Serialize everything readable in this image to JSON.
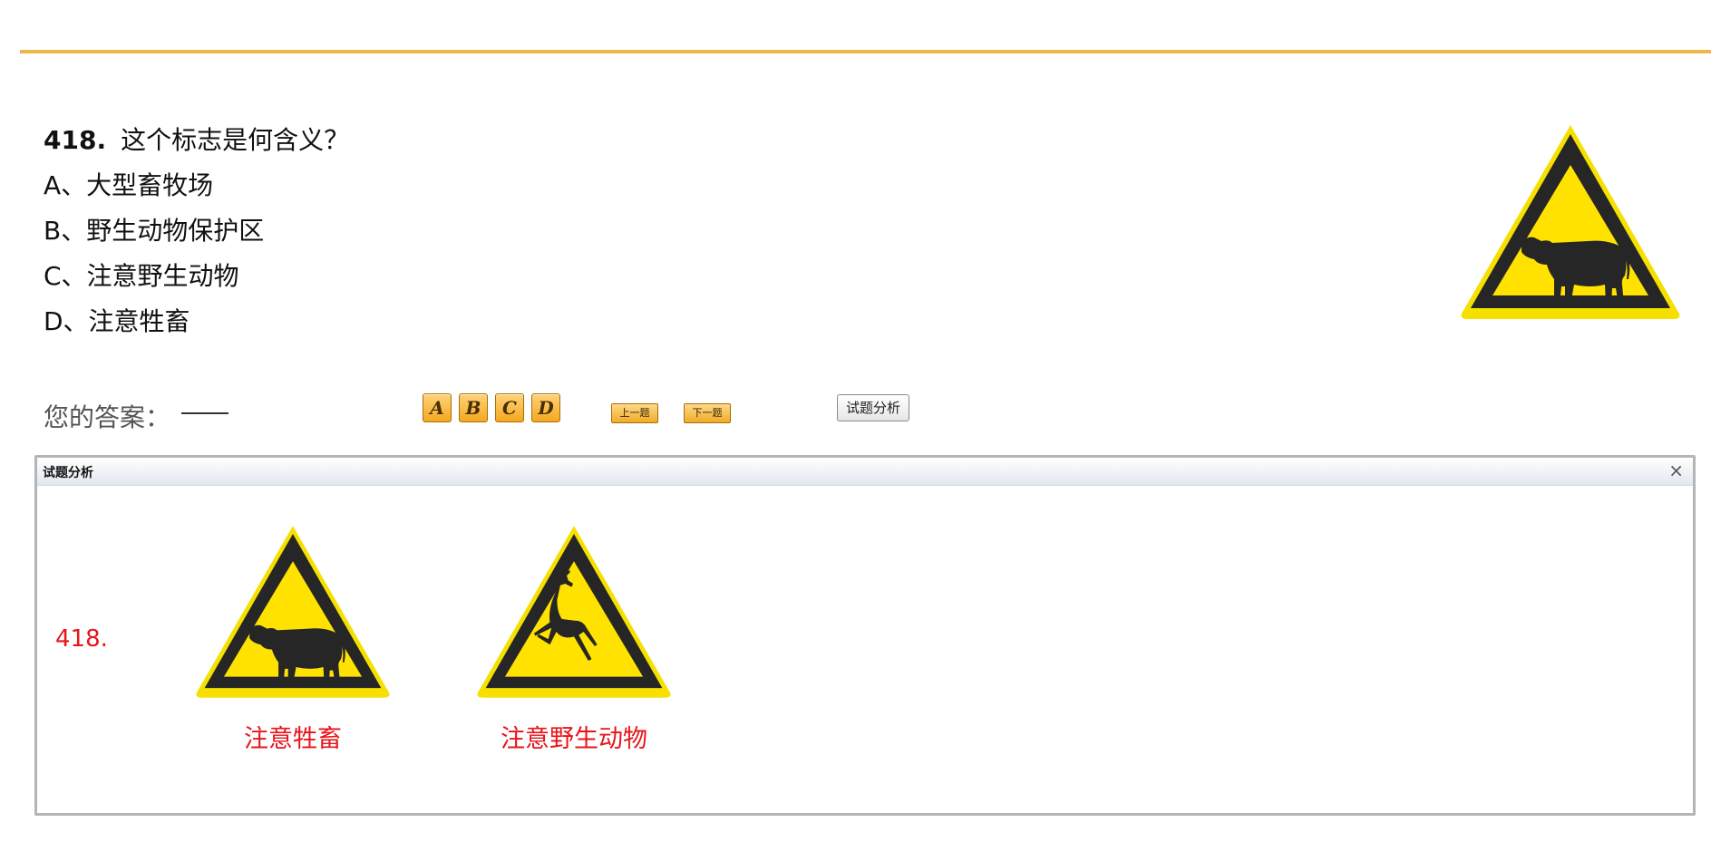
{
  "question": {
    "number": "418.",
    "text": "这个标志是何含义？",
    "options": [
      "A、大型畜牧场",
      "B、野生动物保护区",
      "C、注意野生动物",
      "D、注意牲畜"
    ]
  },
  "main_sign": {
    "icon": "cattle-warning-sign-icon"
  },
  "answer": {
    "label": "您的答案：",
    "letters": [
      "A",
      "B",
      "C",
      "D"
    ],
    "prev_label": "上一题",
    "next_label": "下一题",
    "analysis_label": "试题分析"
  },
  "panel": {
    "title": "试题分析",
    "close": "×",
    "number": "418.",
    "signs": [
      {
        "icon": "cattle-warning-sign-icon",
        "caption": "注意牲畜"
      },
      {
        "icon": "deer-warning-sign-icon",
        "caption": "注意野生动物"
      }
    ]
  },
  "colors": {
    "accent_rule": "#e8b84a",
    "sign_yellow": "#ffe200",
    "caption_red": "#e8141b"
  }
}
